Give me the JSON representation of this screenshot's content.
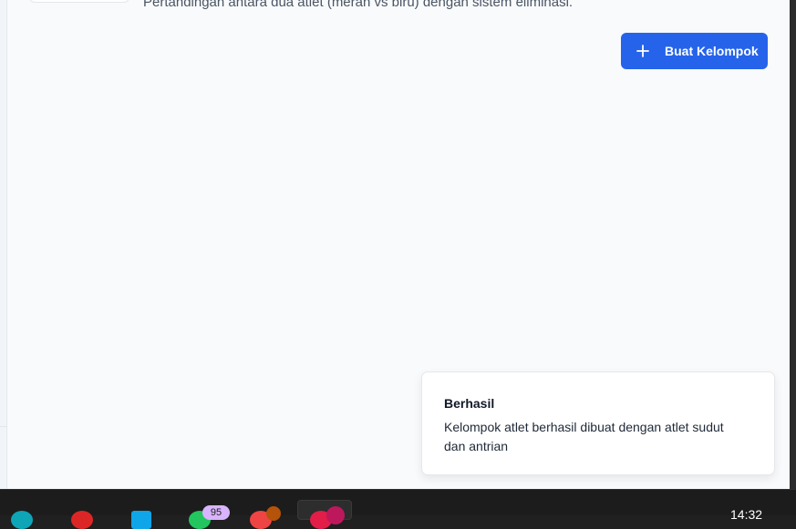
{
  "header": {
    "subtitle": "Pertandingan antara dua atlet (merah vs biru) dengan sistem eliminasi."
  },
  "actions": {
    "create_group_label": "Buat Kelompok"
  },
  "toast": {
    "title": "Berhasil",
    "message": "Kelompok atlet berhasil dibuat dengan atlet sudut dan antrian"
  },
  "taskbar": {
    "badge_count": "95",
    "clock": "14:32",
    "icons": [
      "browser-icon",
      "chrome-icon",
      "files-icon",
      "whatsapp-icon",
      "app-icon",
      "active-app-icon"
    ]
  },
  "colors": {
    "primary": "#2563eb",
    "background": "#f8fafc"
  }
}
